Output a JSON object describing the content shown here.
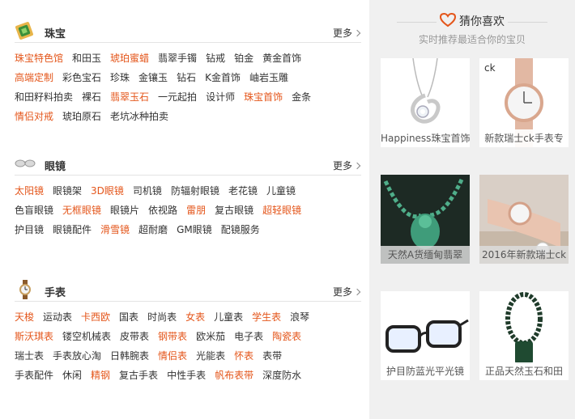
{
  "sections": [
    {
      "title": "珠宝",
      "more": "更多",
      "rows": [
        [
          {
            "t": "珠宝特色馆",
            "hl": true
          },
          {
            "t": "和田玉",
            "hl": false
          },
          {
            "t": "琥珀蜜蜡",
            "hl": true
          },
          {
            "t": "翡翠手镯",
            "hl": false
          },
          {
            "t": "钻戒",
            "hl": false
          },
          {
            "t": "铂金",
            "hl": false
          },
          {
            "t": "黄金首饰",
            "hl": false
          }
        ],
        [
          {
            "t": "高端定制",
            "hl": true
          },
          {
            "t": "彩色宝石",
            "hl": false
          },
          {
            "t": "珍珠",
            "hl": false
          },
          {
            "t": "金镶玉",
            "hl": false
          },
          {
            "t": "钻石",
            "hl": false
          },
          {
            "t": "K金首饰",
            "hl": false
          },
          {
            "t": "岫岩玉雕",
            "hl": false
          }
        ],
        [
          {
            "t": "和田籽料拍卖",
            "hl": false
          },
          {
            "t": "裸石",
            "hl": false
          },
          {
            "t": "翡翠玉石",
            "hl": true
          },
          {
            "t": "一元起拍",
            "hl": false
          },
          {
            "t": "设计师",
            "hl": false
          },
          {
            "t": "珠宝首饰",
            "hl": true
          },
          {
            "t": "金条",
            "hl": false
          }
        ],
        [
          {
            "t": "情侣对戒",
            "hl": true
          },
          {
            "t": "琥珀原石",
            "hl": false
          },
          {
            "t": "老坑冰种拍卖",
            "hl": false
          }
        ]
      ]
    },
    {
      "title": "眼镜",
      "more": "更多",
      "rows": [
        [
          {
            "t": "太阳镜",
            "hl": true
          },
          {
            "t": "眼镜架",
            "hl": false
          },
          {
            "t": "3D眼镜",
            "hl": true
          },
          {
            "t": "司机镜",
            "hl": false
          },
          {
            "t": "防辐射眼镜",
            "hl": false
          },
          {
            "t": "老花镜",
            "hl": false
          },
          {
            "t": "儿童镜",
            "hl": false
          }
        ],
        [
          {
            "t": "色盲眼镜",
            "hl": false
          },
          {
            "t": "无框眼镜",
            "hl": true
          },
          {
            "t": "眼镜片",
            "hl": false
          },
          {
            "t": "依视路",
            "hl": false
          },
          {
            "t": "雷朋",
            "hl": true
          },
          {
            "t": "复古眼镜",
            "hl": false
          },
          {
            "t": "超轻眼镜",
            "hl": true
          }
        ],
        [
          {
            "t": "护目镜",
            "hl": false
          },
          {
            "t": "眼镜配件",
            "hl": false
          },
          {
            "t": "滑雪镜",
            "hl": true
          },
          {
            "t": "超耐磨",
            "hl": false
          },
          {
            "t": "GM眼镜",
            "hl": false
          },
          {
            "t": "配镜服务",
            "hl": false
          }
        ]
      ]
    },
    {
      "title": "手表",
      "more": "更多",
      "rows": [
        [
          {
            "t": "天梭",
            "hl": true
          },
          {
            "t": "运动表",
            "hl": false
          },
          {
            "t": "卡西欧",
            "hl": true
          },
          {
            "t": "国表",
            "hl": false
          },
          {
            "t": "时尚表",
            "hl": false
          },
          {
            "t": "女表",
            "hl": true
          },
          {
            "t": "儿童表",
            "hl": false
          },
          {
            "t": "学生表",
            "hl": true
          },
          {
            "t": "浪琴",
            "hl": false
          }
        ],
        [
          {
            "t": "斯沃琪表",
            "hl": true
          },
          {
            "t": "镂空机械表",
            "hl": false
          },
          {
            "t": "皮带表",
            "hl": false
          },
          {
            "t": "钢带表",
            "hl": true
          },
          {
            "t": "欧米茄",
            "hl": false
          },
          {
            "t": "电子表",
            "hl": false
          },
          {
            "t": "陶瓷表",
            "hl": true
          }
        ],
        [
          {
            "t": "瑞士表",
            "hl": false
          },
          {
            "t": "手表放心淘",
            "hl": false
          },
          {
            "t": "日韩腕表",
            "hl": false
          },
          {
            "t": "情侣表",
            "hl": true
          },
          {
            "t": "光能表",
            "hl": false
          },
          {
            "t": "怀表",
            "hl": true
          },
          {
            "t": "表带",
            "hl": false
          }
        ],
        [
          {
            "t": "手表配件",
            "hl": false
          },
          {
            "t": "休闲",
            "hl": false
          },
          {
            "t": "精钢",
            "hl": true
          },
          {
            "t": "复古手表",
            "hl": false
          },
          {
            "t": "中性手表",
            "hl": false
          },
          {
            "t": "帆布表带",
            "hl": true
          },
          {
            "t": "深度防水",
            "hl": false
          }
        ]
      ]
    }
  ],
  "guess": {
    "title": "猜你喜欢",
    "subtitle": "实时推荐最适合你的宝贝",
    "items": [
      {
        "caption": "Happiness珠宝首饰",
        "icon": "pendant-necklace-image"
      },
      {
        "caption": "新款瑞士ck手表专",
        "icon": "rose-gold-watch-image"
      },
      {
        "caption": "天然A货缅甸翡翠",
        "icon": "jade-necklace-image"
      },
      {
        "caption": "2016年新款瑞士ck",
        "icon": "wrist-watch-image"
      },
      {
        "caption": "护目防蓝光平光镜",
        "icon": "eyeglasses-image"
      },
      {
        "caption": "正品天然玉石和田",
        "icon": "jade-pendant-image"
      }
    ]
  },
  "colors": {
    "highlight": "#e4561b",
    "accent_heart": "#e4561b",
    "sidebar_bg": "#f0f0f0"
  }
}
